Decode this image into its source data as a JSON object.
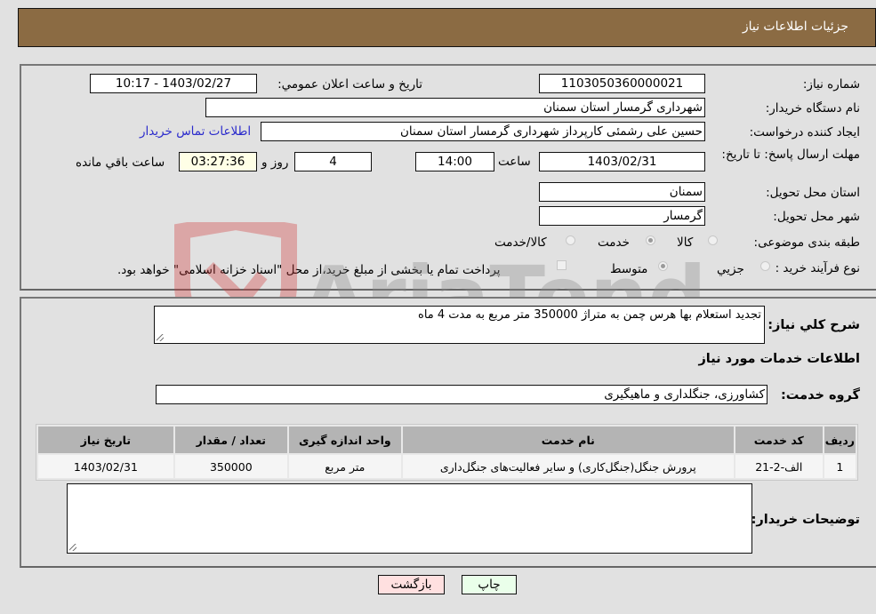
{
  "header": {
    "title": "جزئیات اطلاعات نیاز"
  },
  "details": {
    "need_number_label": "شماره نیاز:",
    "need_number": "1103050360000021",
    "announce_label": "تاریخ و ساعت اعلان عمومي:",
    "announce_value": "1403/02/27 - 10:17",
    "buyer_org_label": "نام دستگاه خریدار:",
    "buyer_org": "شهرداری گرمسار استان سمنان",
    "creator_label": "ایجاد کننده درخواست:",
    "creator": "حسین علی رشمئی کارپرداز شهرداری گرمسار استان سمنان",
    "contact_link": "اطلاعات تماس خریدار",
    "deadline_label": "مهلت ارسال پاسخ: تا تاریخ:",
    "deadline_date": "1403/02/31",
    "time_label": "ساعت",
    "deadline_time": "14:00",
    "days_value": "4",
    "days_label": "روز و",
    "remaining_time": "03:27:36",
    "remaining_label": "ساعت باقي مانده",
    "province_label": "استان محل تحویل:",
    "province": "سمنان",
    "city_label": "شهر محل تحویل:",
    "city": "گرمسار",
    "category_label": "طبقه بندی موضوعی:",
    "category_options": [
      {
        "label": "کالا",
        "selected": false
      },
      {
        "label": "خدمت",
        "selected": true
      },
      {
        "label": "کالا/خدمت",
        "selected": false
      }
    ],
    "process_label": "نوع فرآیند خرید :",
    "process_options": [
      {
        "label": "جزيي",
        "selected": false
      },
      {
        "label": "متوسط",
        "selected": true
      }
    ],
    "treasury_note": "پرداخت تمام یا بخشی از مبلغ خرید،از محل \"اسناد خزانه اسلامی\" خواهد بود.",
    "treasury_checked": false
  },
  "summary": {
    "description_label": "شرح کلي نیاز:",
    "description": "تجدید استعلام بها هرس چمن به متراژ 350000 متر مربع به مدت 4 ماه",
    "services_heading": "اطلاعات خدمات مورد نیاز",
    "service_group_label": "گروه خدمت:",
    "service_group": "کشاورزی، جنگلداری و ماهیگیری"
  },
  "table": {
    "headers": [
      "ردیف",
      "کد خدمت",
      "نام خدمت",
      "واحد اندازه گیری",
      "تعداد / مقدار",
      "تاریخ نیاز"
    ],
    "rows": [
      [
        "1",
        "الف-2-21",
        "پرورش جنگل(جنگل‌کاری) و سایر فعالیت‌های جنگل‌داری",
        "متر مربع",
        "350000",
        "1403/02/31"
      ]
    ]
  },
  "buyer_notes": {
    "label": "توضیحات خریدار:",
    "value": ""
  },
  "buttons": {
    "print": "چاپ",
    "back": "بازگشت"
  },
  "watermark": {
    "text": "AriaTender.neT"
  }
}
